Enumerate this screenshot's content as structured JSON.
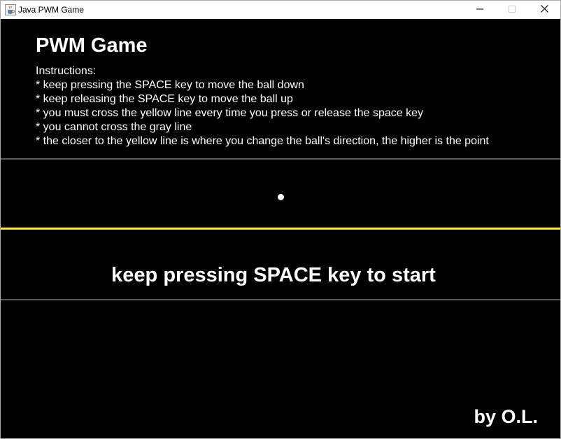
{
  "window": {
    "title": "Java PWM Game",
    "icon": "java-cup-icon",
    "controls": [
      "minimize-icon",
      "maximize-icon",
      "close-icon"
    ]
  },
  "game": {
    "title": "PWM Game",
    "instructions_heading": "Instructions:",
    "instructions": [
      "* keep pressing the SPACE key to move the ball down",
      "* keep releasing the SPACE key to move the ball up",
      "* you must cross the yellow line every time you press or release the space key",
      "* you cannot cross the gray line",
      "* the closer to the yellow line is where you change the ball's direction, the higher is the point"
    ],
    "start_message": "keep pressing SPACE key to start",
    "credit": "by O.L.",
    "colors": {
      "background": "#000000",
      "text": "#ffffff",
      "yellow_line": "#ffeb1f",
      "gray_line": "#5a5a5a",
      "ball": "#ffffff"
    }
  }
}
